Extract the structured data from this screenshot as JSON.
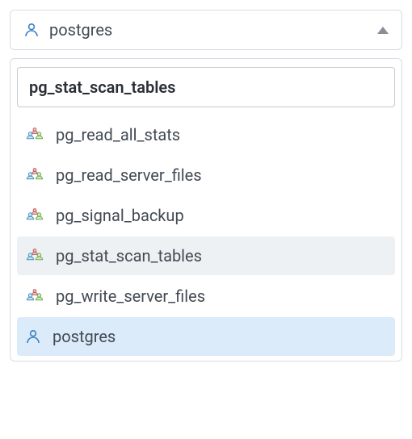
{
  "header": {
    "selected_label": "postgres",
    "icon_type": "single"
  },
  "search": {
    "value": "pg_stat_scan_tables"
  },
  "options": [
    {
      "label": "pg_read_all_stats",
      "icon_type": "group",
      "state": "normal"
    },
    {
      "label": "pg_read_server_files",
      "icon_type": "group",
      "state": "normal"
    },
    {
      "label": "pg_signal_backup",
      "icon_type": "group",
      "state": "normal"
    },
    {
      "label": "pg_stat_scan_tables",
      "icon_type": "group",
      "state": "highlighted"
    },
    {
      "label": "pg_write_server_files",
      "icon_type": "group",
      "state": "normal"
    },
    {
      "label": "postgres",
      "icon_type": "single",
      "state": "selected"
    }
  ],
  "colors": {
    "highlight": "#eef1f4",
    "selected": "#dbebf9",
    "text": "#424a53"
  }
}
